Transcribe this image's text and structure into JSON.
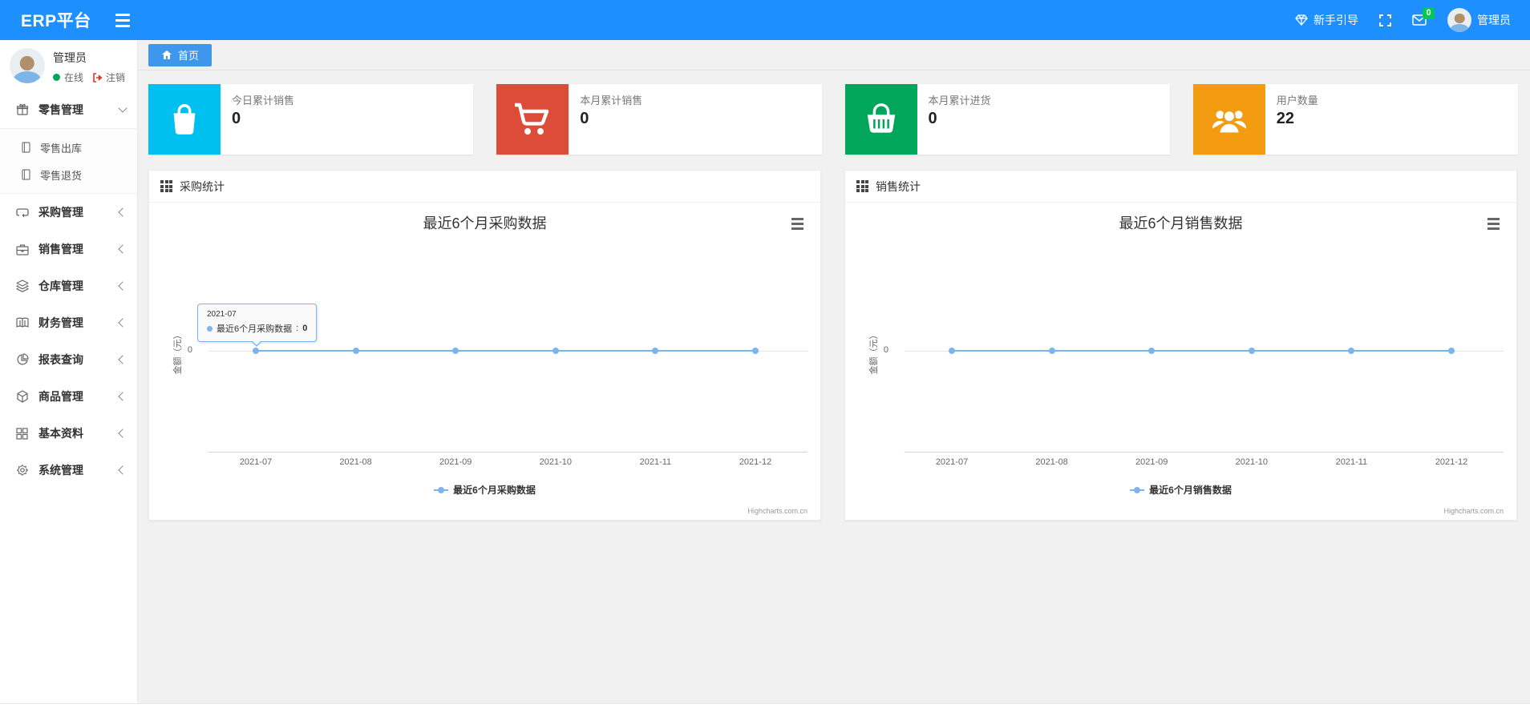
{
  "navbar": {
    "brand": "ERP平台",
    "guide_label": "新手引导",
    "mail_badge": "0",
    "username": "管理员"
  },
  "sidebar": {
    "user": {
      "name": "管理员",
      "status": "在线",
      "logout": "注销"
    },
    "items": [
      {
        "label": "零售管理",
        "icon": "gift-icon",
        "children": [
          {
            "label": "零售出库"
          },
          {
            "label": "零售退货"
          }
        ]
      },
      {
        "label": "采购管理",
        "icon": "repeat-icon"
      },
      {
        "label": "销售管理",
        "icon": "briefcase-icon"
      },
      {
        "label": "仓库管理",
        "icon": "layers-icon"
      },
      {
        "label": "财务管理",
        "icon": "book-icon"
      },
      {
        "label": "报表查询",
        "icon": "pie-chart-icon"
      },
      {
        "label": "商品管理",
        "icon": "cube-icon"
      },
      {
        "label": "基本资料",
        "icon": "grid-icon"
      },
      {
        "label": "系统管理",
        "icon": "gear-icon"
      }
    ]
  },
  "tabs": {
    "home": "首页"
  },
  "cards": [
    {
      "label": "今日累计销售",
      "value": "0",
      "color": "#00c0ef",
      "icon": "shopping-bag-icon"
    },
    {
      "label": "本月累计销售",
      "value": "0",
      "color": "#dd4b39",
      "icon": "shopping-cart-icon"
    },
    {
      "label": "本月累计进货",
      "value": "0",
      "color": "#00a65a",
      "icon": "shopping-basket-icon"
    },
    {
      "label": "用户数量",
      "value": "22",
      "color": "#f39c12",
      "icon": "users-icon"
    }
  ],
  "panels": [
    {
      "header": "采购统计"
    },
    {
      "header": "销售统计"
    }
  ],
  "chart_data": [
    {
      "type": "line",
      "title": "最近6个月采购数据",
      "categories": [
        "2021-07",
        "2021-08",
        "2021-09",
        "2021-10",
        "2021-11",
        "2021-12"
      ],
      "series": [
        {
          "name": "最近6个月采购数据",
          "values": [
            0,
            0,
            0,
            0,
            0,
            0
          ]
        }
      ],
      "xlabel": "",
      "ylabel": "金额（元）",
      "y_tick": "0",
      "ylim": [
        0,
        null
      ],
      "line_color": "#7cb5ec",
      "grid": true,
      "legend_position": "bottom",
      "credits": "Highcharts.com.cn",
      "tooltip": {
        "category": "2021-07",
        "series_name": "最近6个月采购数据",
        "separator": ":",
        "value": "0"
      }
    },
    {
      "type": "line",
      "title": "最近6个月销售数据",
      "categories": [
        "2021-07",
        "2021-08",
        "2021-09",
        "2021-10",
        "2021-11",
        "2021-12"
      ],
      "series": [
        {
          "name": "最近6个月销售数据",
          "values": [
            0,
            0,
            0,
            0,
            0,
            0
          ]
        }
      ],
      "xlabel": "",
      "ylabel": "金额（元）",
      "y_tick": "0",
      "ylim": [
        0,
        null
      ],
      "line_color": "#7cb5ec",
      "grid": true,
      "legend_position": "bottom",
      "credits": "Highcharts.com.cn"
    }
  ]
}
